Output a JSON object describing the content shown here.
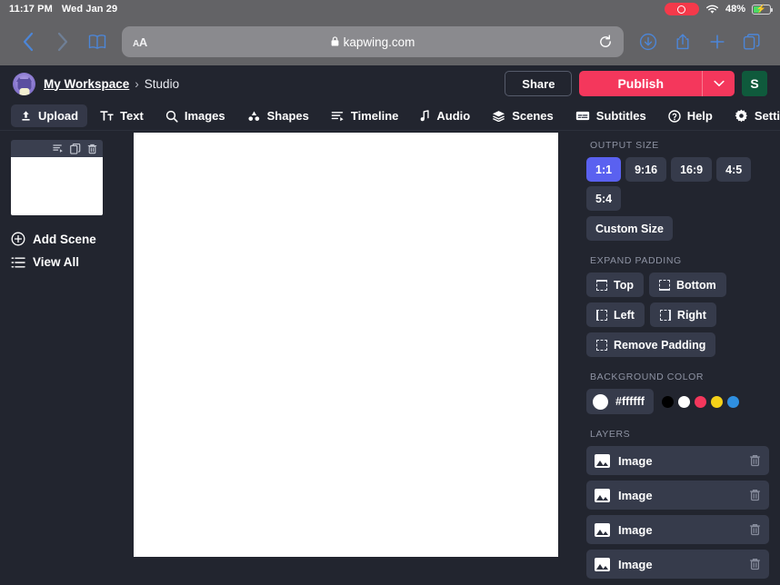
{
  "status_bar": {
    "time": "11:17 PM",
    "date": "Wed Jan 29",
    "battery_percent": "48%",
    "recording_icon": "record-indicator-icon",
    "wifi_icon": "wifi-icon",
    "battery_icon": "battery-charging-icon"
  },
  "browser": {
    "back_icon": "chevron-left-icon",
    "forward_icon": "chevron-right-icon",
    "bookmarks_icon": "book-icon",
    "text_size_label": "aA",
    "lock_icon": "lock-icon",
    "url": "kapwing.com",
    "reload_icon": "reload-icon",
    "downloads_icon": "download-icon",
    "share_icon": "share-icon",
    "new_tab_icon": "plus-icon",
    "tabs_icon": "tabs-icon"
  },
  "header": {
    "avatar_icon": "workspace-avatar",
    "breadcrumb_workspace": "My Workspace",
    "breadcrumb_separator": "›",
    "breadcrumb_current": "Studio",
    "share_label": "Share",
    "publish_label": "Publish",
    "publish_caret_icon": "chevron-down-icon",
    "user_initial": "S",
    "publish_color": "#f4375c",
    "user_avatar_color": "#0f5a3c"
  },
  "tool_tabs": [
    {
      "label": "Upload",
      "icon": "upload-icon",
      "active": true
    },
    {
      "label": "Text",
      "icon": "text-icon",
      "active": false
    },
    {
      "label": "Images",
      "icon": "search-icon",
      "active": false
    },
    {
      "label": "Shapes",
      "icon": "shapes-icon",
      "active": false
    },
    {
      "label": "Timeline",
      "icon": "timeline-icon",
      "active": false
    },
    {
      "label": "Audio",
      "icon": "music-note-icon",
      "active": false
    },
    {
      "label": "Scenes",
      "icon": "layers-icon",
      "active": false
    },
    {
      "label": "Subtitles",
      "icon": "subtitles-icon",
      "active": false
    },
    {
      "label": "Help",
      "icon": "help-circle-icon",
      "active": false
    },
    {
      "label": "Settings",
      "icon": "gear-icon",
      "active": false
    }
  ],
  "scene_rail": {
    "duration_icon": "duration-icon",
    "duplicate_icon": "duplicate-icon",
    "delete_icon": "trash-icon",
    "add_scene_label": "Add Scene",
    "add_scene_icon": "plus-circle-icon",
    "view_all_label": "View All",
    "view_all_icon": "list-icon"
  },
  "panel": {
    "output_size_label": "OUTPUT SIZE",
    "ratios": [
      "1:1",
      "9:16",
      "16:9",
      "4:5",
      "5:4"
    ],
    "selected_ratio": "1:1",
    "selected_ratio_color": "#5a61f0",
    "custom_size_label": "Custom Size",
    "expand_padding_label": "EXPAND PADDING",
    "padding_buttons": [
      "Top",
      "Bottom",
      "Left",
      "Right",
      "Remove Padding"
    ],
    "background_color_label": "BACKGROUND COLOR",
    "background_hex": "#ffffff",
    "preset_colors": [
      "#000000",
      "#ffffff",
      "#f4375c",
      "#f5d118",
      "#2f8fe0"
    ],
    "layers_label": "LAYERS",
    "layers": [
      {
        "name": "Image",
        "icon": "image-icon",
        "delete_icon": "trash-icon"
      },
      {
        "name": "Image",
        "icon": "image-icon",
        "delete_icon": "trash-icon"
      },
      {
        "name": "Image",
        "icon": "image-icon",
        "delete_icon": "trash-icon"
      },
      {
        "name": "Image",
        "icon": "image-icon",
        "delete_icon": "trash-icon"
      }
    ]
  }
}
